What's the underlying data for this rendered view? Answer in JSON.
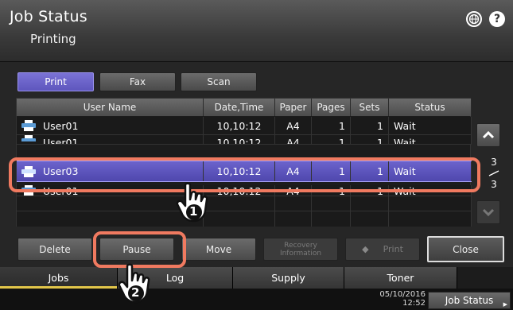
{
  "header": {
    "title": "Job Status",
    "subtitle": "Printing"
  },
  "type_tabs": [
    {
      "label": "Print",
      "active": true
    },
    {
      "label": "Fax",
      "active": false
    },
    {
      "label": "Scan",
      "active": false
    }
  ],
  "table": {
    "columns": [
      "User Name",
      "Date,Time",
      "Paper",
      "Pages",
      "Sets",
      "Status"
    ],
    "rows": [
      {
        "user": "User01",
        "date": "10,10:12",
        "paper": "A4",
        "pages": "1",
        "sets": "1",
        "status": "Wait",
        "selected": false
      },
      {
        "user": "User01",
        "date": "10,10:12",
        "paper": "A4",
        "pages": "1",
        "sets": "1",
        "status": "Wait",
        "selected": false
      },
      {
        "user": "User03",
        "date": "10,10:12",
        "paper": "A4",
        "pages": "1",
        "sets": "1",
        "status": "Wait",
        "selected": true
      },
      {
        "user": "User01",
        "date": "10,10:12",
        "paper": "A4",
        "pages": "1",
        "sets": "1",
        "status": "Wait",
        "selected": false
      }
    ]
  },
  "pager": {
    "current": "3",
    "total": "3"
  },
  "actions": {
    "delete": "Delete",
    "pause": "Pause",
    "move": "Move",
    "recovery": "Recovery Information",
    "print": "Print",
    "close": "Close"
  },
  "bottom_tabs": [
    {
      "label": "Jobs",
      "active": true
    },
    {
      "label": "Log",
      "active": false
    },
    {
      "label": "Supply",
      "active": false
    },
    {
      "label": "Toner",
      "active": false
    }
  ],
  "status": {
    "date": "05/10/2016",
    "time": "12:52",
    "job_status_label": "Job Status"
  },
  "callouts": {
    "step1": "1",
    "step2": "2"
  },
  "colors": {
    "accent": "#5e56bd",
    "highlight": "#f07a60",
    "tab_indicator": "#e2c64a"
  }
}
